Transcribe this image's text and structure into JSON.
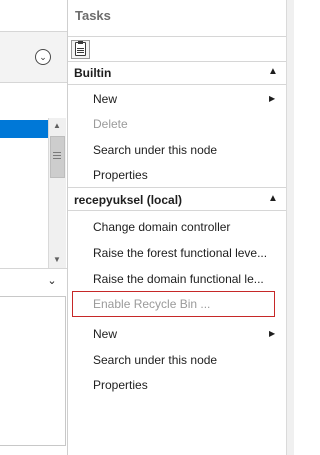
{
  "tasks": {
    "title": "Tasks",
    "sections": [
      {
        "header": "Builtin",
        "items": [
          {
            "label": "New",
            "disabled": false,
            "submenu": true
          },
          {
            "label": "Delete",
            "disabled": true,
            "submenu": false
          },
          {
            "label": "Search under this node",
            "disabled": false,
            "submenu": false
          },
          {
            "label": "Properties",
            "disabled": false,
            "submenu": false
          }
        ]
      },
      {
        "header": "recepyuksel (local)",
        "items": [
          {
            "label": "Change domain controller",
            "disabled": false,
            "submenu": false
          },
          {
            "label": "Raise the forest functional leve...",
            "disabled": false,
            "submenu": false
          },
          {
            "label": "Raise the domain functional le...",
            "disabled": false,
            "submenu": false
          },
          {
            "label": "Enable Recycle Bin ...",
            "disabled": true,
            "submenu": false,
            "highlighted": true
          },
          {
            "label": "New",
            "disabled": false,
            "submenu": true
          },
          {
            "label": "Search under this node",
            "disabled": false,
            "submenu": false
          },
          {
            "label": "Properties",
            "disabled": false,
            "submenu": false
          }
        ]
      }
    ]
  },
  "icons": {
    "chevron_circle": "chevron-down-circle-icon",
    "clipboard": "clipboard-icon",
    "section_collapse": "chevron-up-icon",
    "submenu": "triangle-right-icon",
    "collapse_down": "chevron-down-icon"
  },
  "glyphs": {
    "chevron_circle": "⌄",
    "section_caret": "▲",
    "submenu": "▶",
    "scroll_up": "▲",
    "scroll_down": "▼",
    "collapse_down": "⌄"
  },
  "colors": {
    "selection": "#0078d7",
    "highlight_box": "#c62828",
    "disabled_text": "#9a9a9a",
    "title_text": "#6d6d6d"
  }
}
